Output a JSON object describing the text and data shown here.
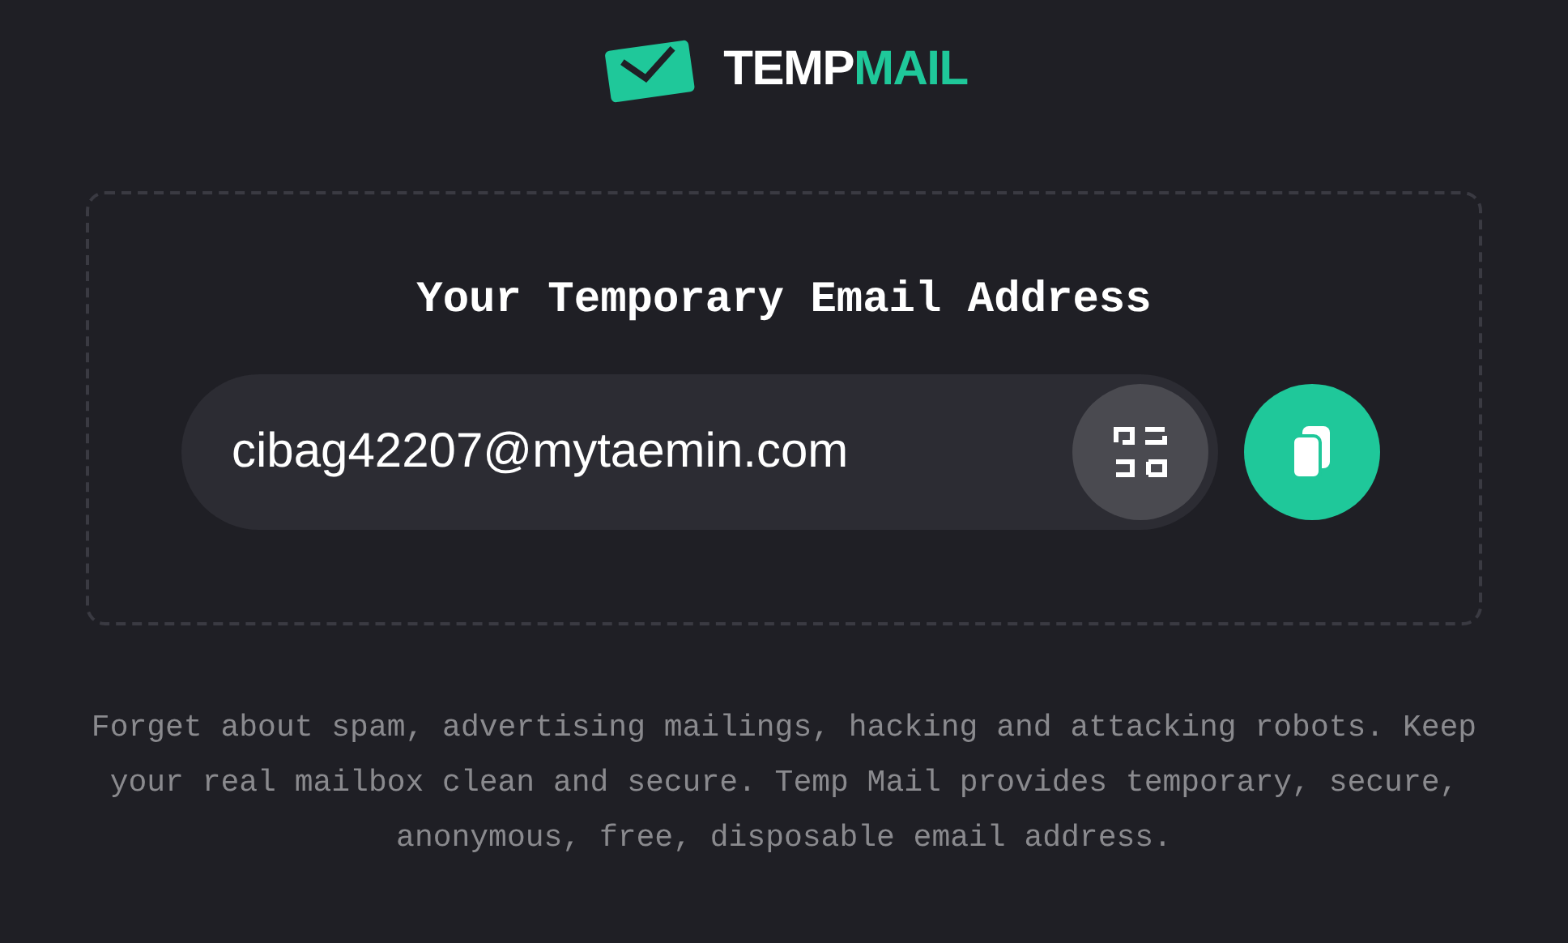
{
  "logo": {
    "first": "TEMP",
    "second": "MAIL"
  },
  "card": {
    "title": "Your Temporary Email Address",
    "email": "cibag42207@mytaemin.com"
  },
  "description": "Forget about spam, advertising mailings, hacking and attacking robots. Keep your real mailbox clean and secure. Temp Mail provides temporary, secure, anonymous, free, disposable email address."
}
